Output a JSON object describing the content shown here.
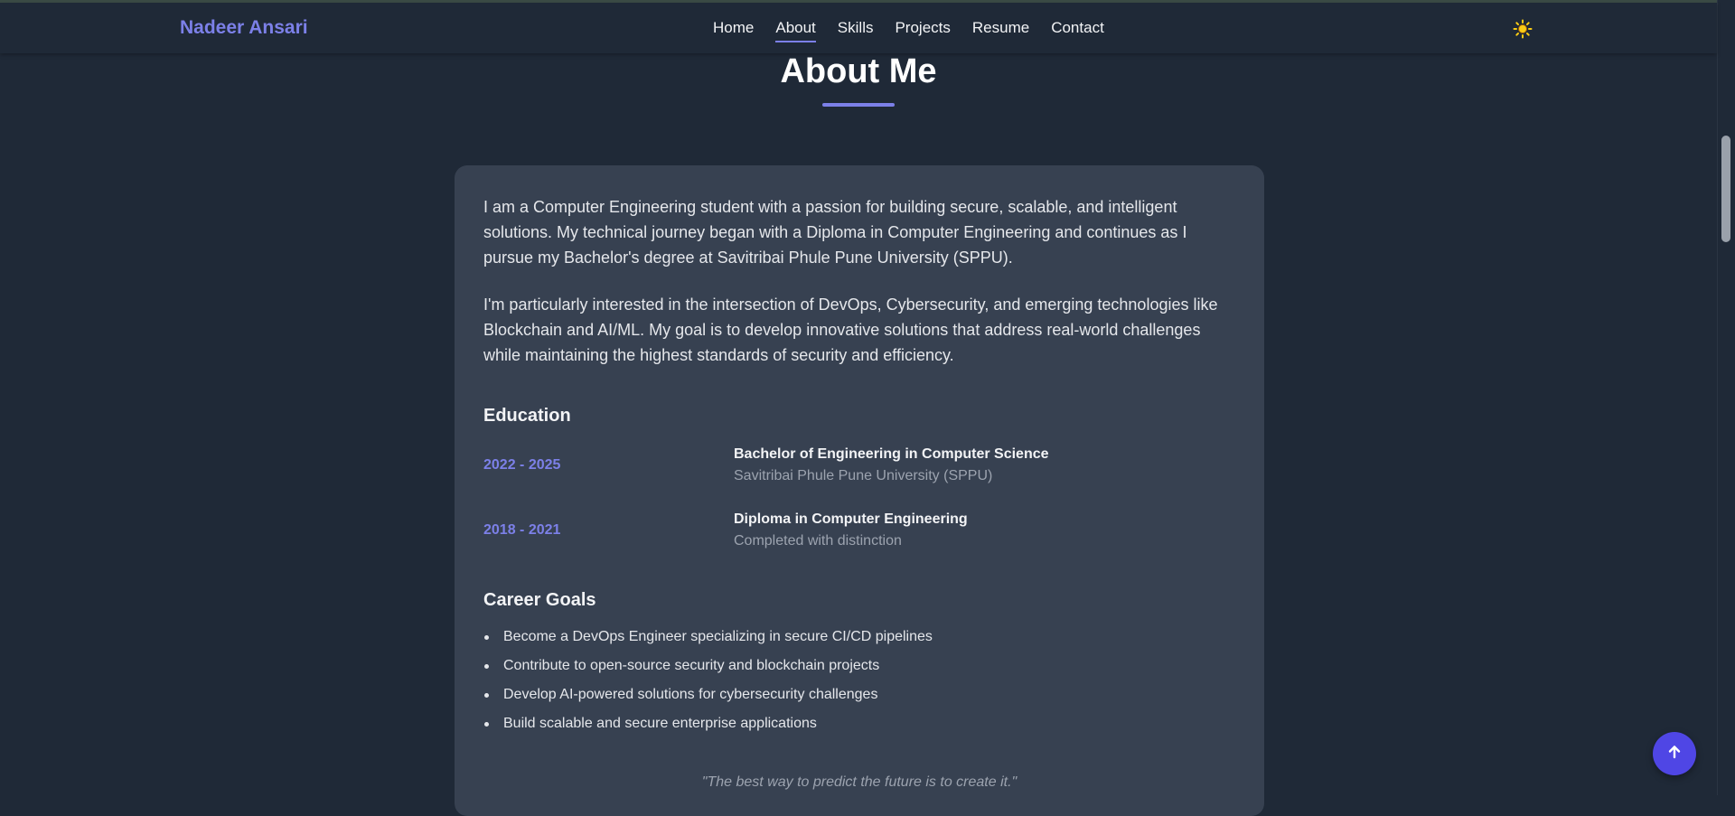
{
  "nav": {
    "brand": "Nadeer Ansari",
    "links": [
      "Home",
      "About",
      "Skills",
      "Projects",
      "Resume",
      "Contact"
    ],
    "active": "About",
    "theme_icon": "sun-icon"
  },
  "about": {
    "title": "About Me",
    "paragraphs": [
      "I am a Computer Engineering student with a passion for building secure, scalable, and intelligent solutions. My technical journey began with a Diploma in Computer Engineering and continues as I pursue my Bachelor's degree at Savitribai Phule Pune University (SPPU).",
      "I'm particularly interested in the intersection of DevOps, Cybersecurity, and emerging technologies like Blockchain and AI/ML. My goal is to develop innovative solutions that address real-world challenges while maintaining the highest standards of security and efficiency."
    ],
    "education_heading": "Education",
    "education": [
      {
        "years": "2022 - 2025",
        "degree": "Bachelor of Engineering in Computer Science",
        "school": "Savitribai Phule Pune University (SPPU)"
      },
      {
        "years": "2018 - 2021",
        "degree": "Diploma in Computer Engineering",
        "school": "Completed with distinction"
      }
    ],
    "goals_heading": "Career Goals",
    "goals": [
      "Become a DevOps Engineer specializing in secure CI/CD pipelines",
      "Contribute to open-source security and blockchain projects",
      "Develop AI-powered solutions for cybersecurity challenges",
      "Build scalable and secure enterprise applications"
    ],
    "quote": "\"The best way to predict the future is to create it.\""
  },
  "scroll_top": {
    "icon": "arrow-up-icon"
  },
  "colors": {
    "accent": "#7c80e8",
    "background": "#1f2937",
    "card": "#374151",
    "button": "#4f46e5"
  }
}
